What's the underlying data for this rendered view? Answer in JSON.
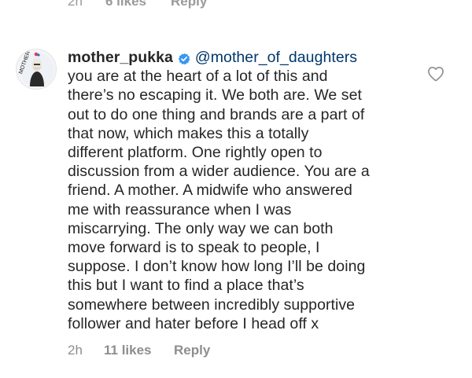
{
  "previous_comment_meta": {
    "time": "2h",
    "likes": "6 likes",
    "reply": "Reply"
  },
  "comment": {
    "username": "mother_pukka",
    "verified": true,
    "mention": "@mother_of_daughters",
    "lines": [
      "you are at the heart of a lot of this and",
      "there’s no escaping it. We both are. We set",
      "out to do one thing and brands are a part of",
      "that now, which makes this a totally",
      "different platform. One rightly open to",
      "discussion from a wider audience. You are a",
      "friend. A mother. A midwife who answered",
      "me with reassurance when I was",
      "miscarrying. The only way we can both",
      "move forward is to speak to people, I",
      "suppose. I don’t know how long I’ll be doing",
      "this but I want to find a place that’s",
      "somewhere between incredibly supportive",
      "follower and hater before I head off x"
    ],
    "time": "2h",
    "likes": "11 likes",
    "reply": "Reply"
  },
  "icons": {
    "avatar": "profile-avatar",
    "verified": "verified-badge-icon",
    "like": "heart-outline-icon"
  },
  "colors": {
    "verified_badge": "#3897f0",
    "mention": "#00376b",
    "meta_text": "#8e8e8e",
    "body_text": "#262626"
  }
}
